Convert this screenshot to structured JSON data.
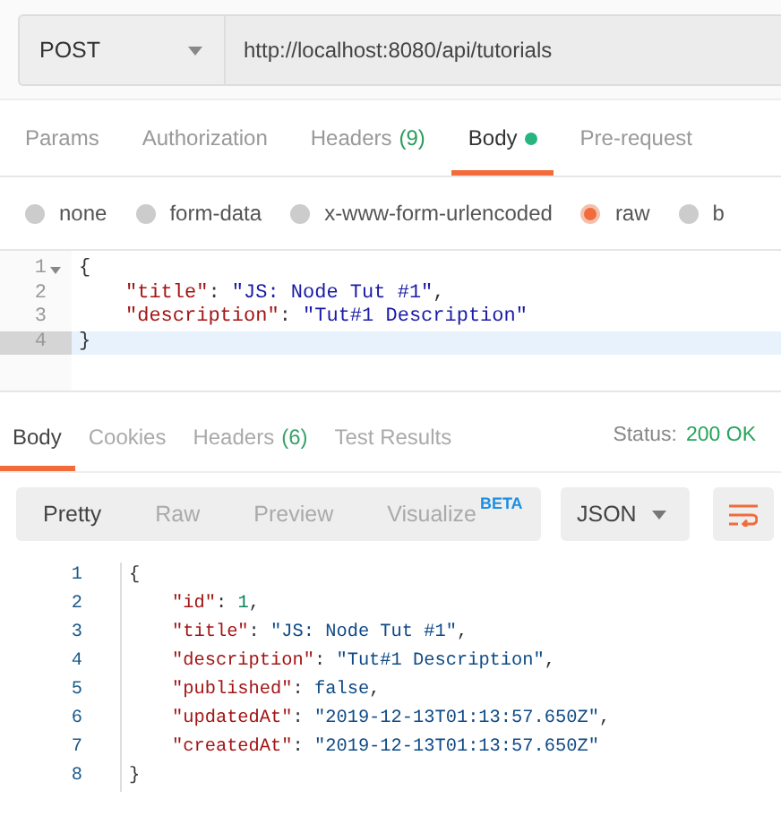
{
  "request": {
    "method": "POST",
    "url": "http://localhost:8080/api/tutorials"
  },
  "request_tabs": [
    {
      "label": "Params",
      "selected": false
    },
    {
      "label": "Authorization",
      "selected": false
    },
    {
      "label": "Headers",
      "count": "(9)",
      "selected": false
    },
    {
      "label": "Body",
      "dot": true,
      "selected": true
    },
    {
      "label": "Pre-request",
      "selected": false
    }
  ],
  "body_types": [
    {
      "label": "none",
      "selected": false
    },
    {
      "label": "form-data",
      "selected": false
    },
    {
      "label": "x-www-form-urlencoded",
      "selected": false
    },
    {
      "label": "raw",
      "selected": true
    },
    {
      "label": "b",
      "selected": false
    }
  ],
  "request_body": [
    {
      "number": "1",
      "foldable": true,
      "current": false,
      "tokens": [
        {
          "kind": "punct",
          "text": "{"
        }
      ],
      "children": [
        {
          "number": "2",
          "current": false,
          "tokens": [
            {
              "kind": "key",
              "text": "\"title\""
            },
            {
              "kind": "punct",
              "text": ": "
            },
            {
              "kind": "string",
              "text": "\"JS: Node Tut #1\""
            },
            {
              "kind": "punct",
              "text": ","
            }
          ]
        },
        {
          "number": "3",
          "current": false,
          "tokens": [
            {
              "kind": "key",
              "text": "\"description\""
            },
            {
              "kind": "punct",
              "text": ": "
            },
            {
              "kind": "string",
              "text": "\"Tut#1 Description\""
            }
          ]
        }
      ]
    },
    {
      "number": "4",
      "current": true,
      "tokens": [
        {
          "kind": "punct",
          "text": "}"
        }
      ]
    }
  ],
  "response_tabs": [
    {
      "label": "Body",
      "selected": true
    },
    {
      "label": "Cookies",
      "selected": false
    },
    {
      "label": "Headers",
      "count": "(6)",
      "selected": false
    },
    {
      "label": "Test Results",
      "selected": false
    }
  ],
  "status": {
    "label": "Status:",
    "value": "200 OK"
  },
  "view_modes": [
    {
      "label": "Pretty",
      "selected": true
    },
    {
      "label": "Raw",
      "selected": false
    },
    {
      "label": "Preview",
      "selected": false
    },
    {
      "label": "Visualize",
      "badge": "BETA",
      "selected": false
    }
  ],
  "format": "JSON",
  "response_body": [
    {
      "number": "1",
      "tokens": [
        {
          "kind": "punct",
          "text": "{"
        }
      ],
      "children": [
        {
          "number": "2",
          "tokens": [
            {
              "kind": "key",
              "text": "\"id\""
            },
            {
              "kind": "punct",
              "text": ": "
            },
            {
              "kind": "number",
              "text": "1"
            },
            {
              "kind": "punct",
              "text": ","
            }
          ]
        },
        {
          "number": "3",
          "tokens": [
            {
              "kind": "key",
              "text": "\"title\""
            },
            {
              "kind": "punct",
              "text": ": "
            },
            {
              "kind": "string",
              "text": "\"JS: Node Tut #1\""
            },
            {
              "kind": "punct",
              "text": ","
            }
          ]
        },
        {
          "number": "4",
          "tokens": [
            {
              "kind": "key",
              "text": "\"description\""
            },
            {
              "kind": "punct",
              "text": ": "
            },
            {
              "kind": "string",
              "text": "\"Tut#1 Description\""
            },
            {
              "kind": "punct",
              "text": ","
            }
          ]
        },
        {
          "number": "5",
          "tokens": [
            {
              "kind": "key",
              "text": "\"published\""
            },
            {
              "kind": "punct",
              "text": ": "
            },
            {
              "kind": "bool",
              "text": "false"
            },
            {
              "kind": "punct",
              "text": ","
            }
          ]
        },
        {
          "number": "6",
          "tokens": [
            {
              "kind": "key",
              "text": "\"updatedAt\""
            },
            {
              "kind": "punct",
              "text": ": "
            },
            {
              "kind": "string",
              "text": "\"2019-12-13T01:13:57.650Z\""
            },
            {
              "kind": "punct",
              "text": ","
            }
          ]
        },
        {
          "number": "7",
          "tokens": [
            {
              "kind": "key",
              "text": "\"createdAt\""
            },
            {
              "kind": "punct",
              "text": ": "
            },
            {
              "kind": "string",
              "text": "\"2019-12-13T01:13:57.650Z\""
            }
          ]
        }
      ]
    },
    {
      "number": "8",
      "tokens": [
        {
          "kind": "punct",
          "text": "}"
        }
      ]
    }
  ]
}
